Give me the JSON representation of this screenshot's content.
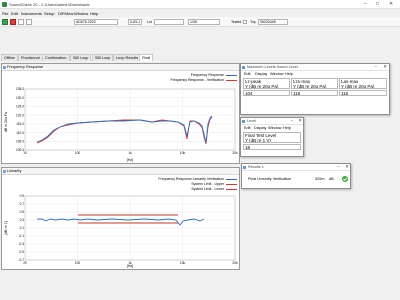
{
  "window": {
    "title": "SoundCheck 20 - C:\\Users\\admin\\Downloads"
  },
  "menu": [
    "File",
    "Edit",
    "Instruments",
    "Setup",
    "DIRView",
    "Window",
    "Help"
  ],
  "toolbar": {
    "sequence_value": "AD075-2022",
    "step_value": "0-63-1",
    "lot_label": "Lot",
    "lot_value": "",
    "counter_value": "1/36",
    "tested_label": "Tested",
    "id_label": "Top",
    "id_value": "05220448"
  },
  "tabs": [
    "Offline",
    "Provisional",
    "Confirmation",
    "SiB Loop",
    "SiB Loop",
    "Loop Results",
    "Final"
  ],
  "frequency_panel": {
    "title": "Frequency Response",
    "legend": [
      "Frequency Response",
      "Frequency Response - Verification"
    ],
    "ylabel": "dB re 20u Pa",
    "xlabel": "[Hz]",
    "y_ticks": [
      "135.0",
      "130.0",
      "125.0",
      "120.0",
      "115.0",
      "110.0",
      "105.0",
      "100.0"
    ],
    "x_ticks": [
      "10",
      "100",
      "1k",
      "10k",
      "20k"
    ]
  },
  "linearity_panel": {
    "title": "Linearity",
    "legend": [
      "Frequency Response Linearity Verification",
      "System Limit - Upper",
      "System Limit - Lower"
    ],
    "ylabel": "[dB re 1]",
    "xlabel": "[Hz]",
    "y_ticks": [
      "0.9",
      "0.7",
      "0.5",
      "0.3",
      "0.1",
      "-0.1",
      "-0.3",
      "-0.5",
      "-0.7"
    ],
    "x_ticks": [
      "20",
      "100",
      "1k",
      "10k",
      "20k"
    ]
  },
  "max_levels_window": {
    "title": "Maximum Levels Sound Level",
    "menu": [
      "Edit",
      "Display",
      "Window",
      "Help"
    ],
    "headers": [
      [
        "Lz-peak",
        "Y (dB re 20u Pa)"
      ],
      [
        "Lzs-max",
        "Y (dB re 20u Pa)"
      ],
      [
        "Las-max",
        "Y (dB re 20u Pa)"
      ]
    ],
    "values": [
      "104",
      "118",
      "116"
    ]
  },
  "level_window": {
    "title": "Level",
    "menu": [
      "Edit",
      "Display",
      "Window",
      "Help"
    ],
    "header": [
      "Final Test Level",
      "Y (dB re 1 V)"
    ],
    "value": "18"
  },
  "results_window": {
    "title": "Results 1",
    "row_label": "Final Linearity Verification",
    "row_value": "320m",
    "row_unit": "dB"
  },
  "colors": {
    "trace_blue": "#2f6fc4",
    "trace_red": "#d43a2f",
    "limit_upper": "#c0392b",
    "limit_lower": "#c0392b",
    "pass_green": "#3aa93a"
  }
}
